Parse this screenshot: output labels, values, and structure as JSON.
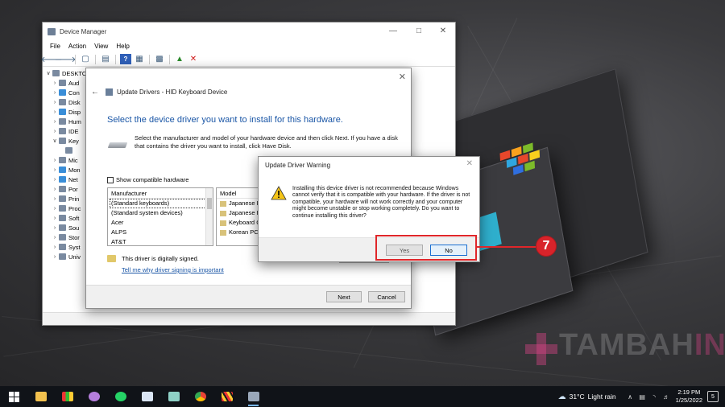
{
  "device_manager": {
    "title": "Device Manager",
    "menu": [
      "File",
      "Action",
      "View",
      "Help"
    ],
    "tree_root": "DESKTO",
    "tree_items": [
      "Aud",
      "Con",
      "Disk",
      "Disp",
      "Hum",
      "IDE",
      "Key",
      "",
      "Mic",
      "Mon",
      "Net",
      "Por",
      "Prin",
      "Proc",
      "Soft",
      "Sou",
      "Stor",
      "Syst",
      "Univ"
    ]
  },
  "update_drivers": {
    "title": "Update Drivers - HID Keyboard Device",
    "heading": "Select the device driver you want to install for this hardware.",
    "description": "Select the manufacturer and model of your hardware device and then click Next. If you have a disk that contains the driver you want to install, click Have Disk.",
    "show_compatible": "Show compatible hardware",
    "manufacturer_header": "Manufacturer",
    "manufacturers": [
      "(Standard keyboards)",
      "(Standard system devices)",
      "Acer",
      "ALPS",
      "AT&T"
    ],
    "model_header": "Model",
    "models": [
      "Japanese P",
      "Japanese P",
      "Keyboard C",
      "Korean PC"
    ],
    "signed_text": "This driver is digitally signed.",
    "signing_link": "Tell me why driver signing is important",
    "next_label": "Next",
    "cancel_label": "Cancel"
  },
  "warning": {
    "title": "Update Driver Warning",
    "message": "Installing this device driver is not recommended because Windows cannot verify that it is compatible with your hardware.  If the driver is not compatible, your hardware will not work correctly and your computer might become unstable or stop working completely.  Do you want to continue installing this driver?",
    "yes_label": "Yes",
    "no_label": "No"
  },
  "annotation": {
    "step": "7",
    "color": "#e0262a"
  },
  "watermark": {
    "part1": "TAMBAH",
    "part2": "INFO"
  },
  "taskbar": {
    "temperature": "31°C",
    "weather": "Light rain",
    "time": "2:19 PM",
    "date": "1/25/2022",
    "notifications": "5"
  }
}
